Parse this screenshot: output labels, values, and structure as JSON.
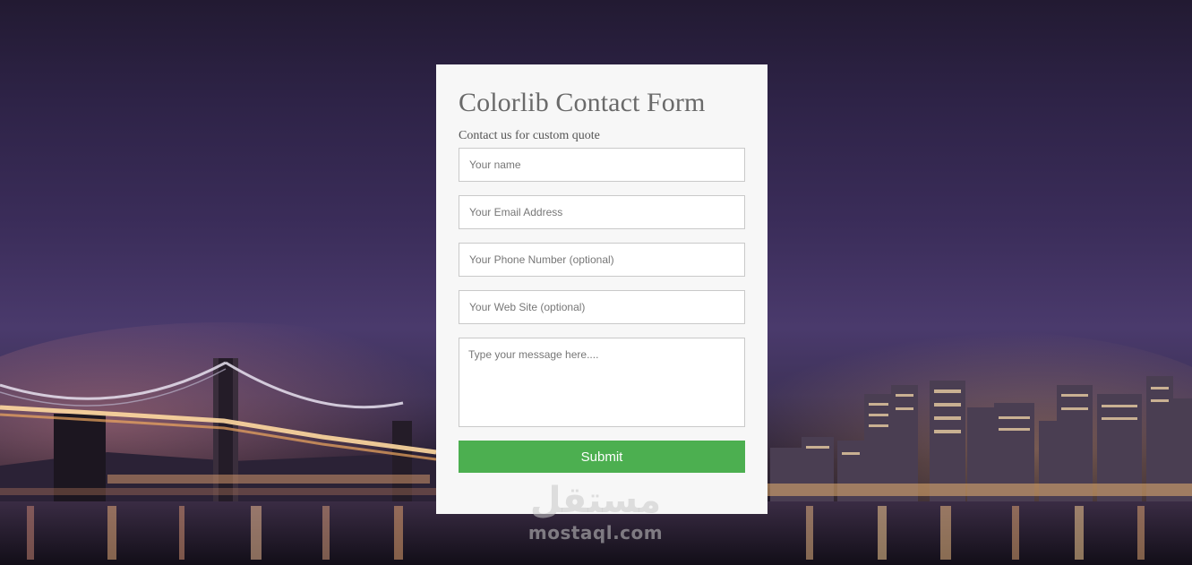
{
  "form": {
    "title": "Colorlib Contact Form",
    "subtitle": "Contact us for custom quote",
    "name_placeholder": "Your name",
    "email_placeholder": "Your Email Address",
    "phone_placeholder": "Your Phone Number (optional)",
    "website_placeholder": "Your Web Site (optional)",
    "message_placeholder": "Type your message here....",
    "submit_label": "Submit",
    "card_color": "#f7f7f7",
    "button_color": "#4caf50"
  },
  "background": {
    "description_icon": "night-city-bridge-image"
  },
  "watermark": {
    "arabic": "مستقل",
    "latin": "mostaql.com"
  }
}
